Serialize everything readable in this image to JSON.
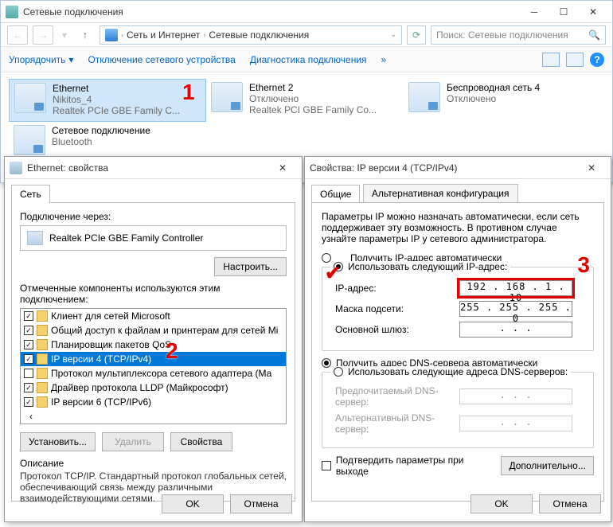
{
  "explorer": {
    "title": "Сетевые подключения",
    "crumb1": "Сеть и Интернет",
    "crumb2": "Сетевые подключения",
    "search_ph": "Поиск: Сетевые подключения",
    "cmd_org": "Упорядочить",
    "cmd_disable": "Отключение сетевого устройства",
    "cmd_diag": "Диагностика подключения",
    "chev": "▾",
    "raquo": "»",
    "items": [
      {
        "title": "Ethernet",
        "sub1": "Nikitos_4",
        "sub2": "Realtek PCIe GBE Family C..."
      },
      {
        "title": "Ethernet 2",
        "sub1": "Отключено",
        "sub2": "Realtek PCI GBE Family Co..."
      },
      {
        "title": "Беспроводная сеть 4",
        "sub1": "Отключено",
        "sub2": ""
      },
      {
        "title": "Сетевое подключение",
        "sub1": "Bluetooth",
        "sub2": ""
      }
    ]
  },
  "eth": {
    "title": "Ethernet: свойства",
    "tab": "Сеть",
    "conn_via": "Подключение через:",
    "adapter": "Realtek PCIe GBE Family Controller",
    "configure": "Настроить...",
    "used_by": "Отмеченные компоненты используются этим подключением:",
    "items": [
      "Клиент для сетей Microsoft",
      "Общий доступ к файлам и принтерам для сетей Mi",
      "Планировщик пакетов QoS",
      "IP версии 4 (TCP/IPv4)",
      "Протокол мультиплексора сетевого адаптера (Ма",
      "Драйвер протокола LLDP (Майкрософт)",
      "IP версии 6 (TCP/IPv6)"
    ],
    "install": "Установить...",
    "remove": "Удалить",
    "props": "Свойства",
    "desc_t": "Описание",
    "desc": "Протокол TCP/IP. Стандартный протокол глобальных сетей, обеспечивающий связь между различными взаимодействующими сетями.",
    "ok": "OK",
    "cancel": "Отмена"
  },
  "ip": {
    "title": "Свойства: IP версии 4 (TCP/IPv4)",
    "tab1": "Общие",
    "tab2": "Альтернативная конфигурация",
    "para": "Параметры IP можно назначать автоматически, если сеть поддерживает эту возможность. В противном случае узнайте параметры IP у сетевого администратора.",
    "r_auto_ip": "Получить IP-адрес автоматически",
    "r_use_ip": "Использовать следующий IP-адрес:",
    "f_ip": "IP-адрес:",
    "f_mask": "Маска подсети:",
    "f_gw": "Основной шлюз:",
    "v_ip": "192 . 168 .  1  . 10",
    "v_mask": "255 . 255 . 255 .  0",
    "v_gw": ".       .       .",
    "r_auto_dns": "Получить адрес DNS-сервера автоматически",
    "r_use_dns": "Использовать следующие адреса DNS-серверов:",
    "f_dns1": "Предпочитаемый DNS-сервер:",
    "f_dns2": "Альтернативный DNS-сервер:",
    "v_blank": ".       .       .",
    "chk_validate": "Подтвердить параметры при выходе",
    "advanced": "Дополнительно...",
    "ok": "OK",
    "cancel": "Отмена"
  },
  "markers": {
    "m1": "1",
    "m2": "2",
    "m3": "3",
    "check": "✔"
  }
}
